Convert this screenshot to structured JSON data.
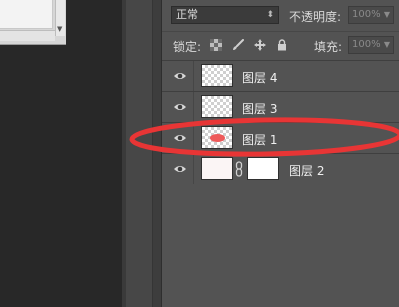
{
  "layers_panel": {
    "blend_mode": "正常",
    "opacity_label": "不透明度:",
    "opacity_value": "100%",
    "lock_label": "锁定:",
    "fill_label": "填充:",
    "fill_value": "100%",
    "layers": [
      {
        "name": "图层 4",
        "thumbnail": "transparent"
      },
      {
        "name": "图层 3",
        "thumbnail": "transparent"
      },
      {
        "name": "图层 1",
        "thumbnail": "red-blob"
      },
      {
        "name": "图层 2",
        "thumbnail": "solid-with-mask"
      }
    ]
  },
  "icons": {
    "eye": "eye-icon",
    "lock_transparent": "checkerboard-lock-icon",
    "lock_paint": "brush-icon",
    "lock_position": "move-icon",
    "lock_all": "padlock-icon",
    "mask_link": "chain-icon"
  },
  "colors": {
    "panel_bg": "#535353",
    "annotation": "#e83535",
    "blob": "#ee5a5a"
  }
}
